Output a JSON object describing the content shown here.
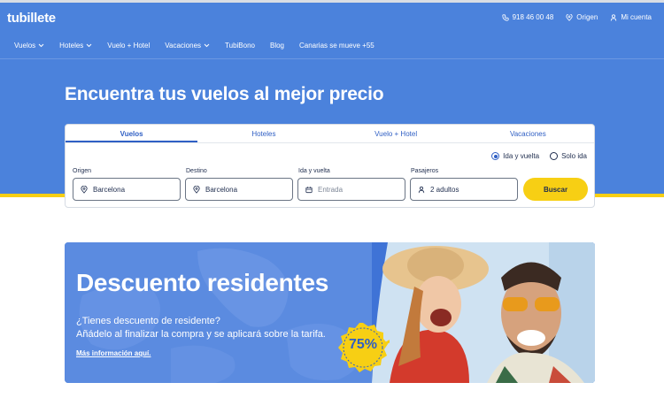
{
  "brand": {
    "logo": "tubillete"
  },
  "top_links": {
    "phone": "918 46 00 48",
    "origin": "Origen",
    "account": "Mi cuenta"
  },
  "nav": [
    {
      "label": "Vuelos",
      "dropdown": true
    },
    {
      "label": "Hoteles",
      "dropdown": true
    },
    {
      "label": "Vuelo + Hotel",
      "dropdown": false
    },
    {
      "label": "Vacaciones",
      "dropdown": true
    },
    {
      "label": "TubiBono",
      "dropdown": false
    },
    {
      "label": "Blog",
      "dropdown": false
    },
    {
      "label": "Canarias se mueve +55",
      "dropdown": false
    }
  ],
  "hero": {
    "title": "Encuentra tus vuelos al mejor precio"
  },
  "search": {
    "tabs": [
      "Vuelos",
      "Hoteles",
      "Vuelo + Hotel",
      "Vacaciones"
    ],
    "active_tab": "Vuelos",
    "trip_type": {
      "round_trip": "Ida y vuelta",
      "one_way": "Solo ida",
      "selected": "Ida y vuelta"
    },
    "origin": {
      "label": "Origen",
      "value": "Barcelona"
    },
    "destination": {
      "label": "Destino",
      "value": "Barcelona"
    },
    "dates": {
      "label": "Ida y vuelta",
      "placeholder": "Entrada"
    },
    "passengers": {
      "label": "Pasajeros",
      "value": "2 adultos"
    },
    "submit": "Buscar"
  },
  "promo": {
    "title": "Descuento residentes",
    "line1": "¿Tienes descuento de residente?",
    "line2": "Añádelo al finalizar la compra y se aplicará sobre la tarifa.",
    "link": "Más información aquí.",
    "badge": "75%"
  },
  "colors": {
    "hero_blue": "#4b82dc",
    "accent_yellow": "#f7cf14",
    "link_blue": "#2f5fc4"
  },
  "icons": [
    "phone-icon",
    "location-pin-icon",
    "user-icon",
    "chevron-down-icon",
    "calendar-icon"
  ]
}
